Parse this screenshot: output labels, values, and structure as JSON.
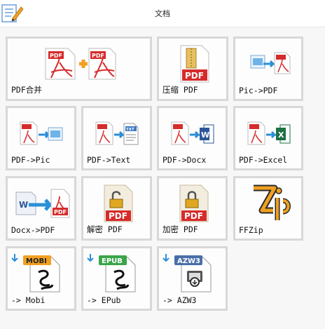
{
  "window": {
    "title": "文档"
  },
  "colors": {
    "pdf_red": "#d62b2b",
    "accent_blue": "#2a8fd6",
    "tile_border": "#d8d8d8"
  },
  "tiles": [
    {
      "label": "PDF合并",
      "icon": "pdf-merge-icon"
    },
    {
      "label": "压缩 PDF",
      "icon": "pdf-compress-icon"
    },
    {
      "label": "Pic->PDF",
      "icon": "pic-to-pdf-icon"
    },
    {
      "label": "PDF->Pic",
      "icon": "pdf-to-pic-icon"
    },
    {
      "label": "PDF->Text",
      "icon": "pdf-to-text-icon"
    },
    {
      "label": "PDF->Docx",
      "icon": "pdf-to-docx-icon"
    },
    {
      "label": "PDF->Excel",
      "icon": "pdf-to-excel-icon"
    },
    {
      "label": "Docx->PDF",
      "icon": "docx-to-pdf-icon"
    },
    {
      "label": "解密 PDF",
      "icon": "pdf-decrypt-icon"
    },
    {
      "label": "加密 PDF",
      "icon": "pdf-encrypt-icon"
    },
    {
      "label": "FFZip",
      "icon": "ffzip-icon"
    },
    {
      "label": "-> Mobi",
      "icon": "to-mobi-icon"
    },
    {
      "label": "-> EPub",
      "icon": "to-epub-icon"
    },
    {
      "label": "-> AZW3",
      "icon": "to-azw3-icon"
    }
  ],
  "icon_text": {
    "pdf": "PDF",
    "txt": "TXT",
    "word": "W",
    "excel": "X",
    "mobi": "MOBI",
    "epub": "EPUB",
    "azw3": "AZW3"
  }
}
